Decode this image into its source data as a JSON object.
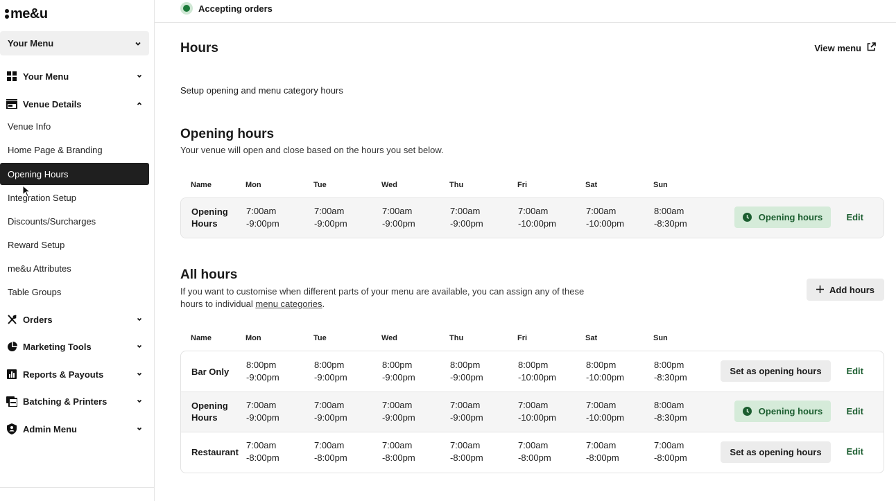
{
  "brand": {
    "logo_text": "me&u"
  },
  "sidebar": {
    "menu_select": "Your Menu",
    "groups": {
      "your_menu": "Your Menu",
      "venue_details": "Venue Details",
      "orders": "Orders",
      "marketing_tools": "Marketing Tools",
      "reports_payouts": "Reports & Payouts",
      "batching_printers": "Batching & Printers",
      "admin_menu": "Admin Menu"
    },
    "venue_items": [
      "Venue Info",
      "Home Page & Branding",
      "Opening Hours",
      "Integration Setup",
      "Discounts/Surcharges",
      "Reward Setup",
      "me&u Attributes",
      "Table Groups"
    ],
    "active_item": "Opening Hours"
  },
  "topbar": {
    "status": "Accepting orders",
    "status_color": "#1c7a3a"
  },
  "page": {
    "title": "Hours",
    "view_menu": "View menu",
    "subtitle": "Setup opening and menu category hours"
  },
  "opening_hours": {
    "title": "Opening hours",
    "description": "Your venue will open and close based on the hours you set below."
  },
  "all_hours": {
    "title": "All hours",
    "description_before": "If you want to customise when different parts of your menu are available, you can assign any of these hours to individual ",
    "description_link": "menu categories",
    "description_after": ".",
    "add_button": "Add hours"
  },
  "columns": [
    "Name",
    "Mon",
    "Tue",
    "Wed",
    "Thu",
    "Fri",
    "Sat",
    "Sun"
  ],
  "labels": {
    "opening_badge": "Opening hours",
    "set_as_opening": "Set as opening hours",
    "edit": "Edit"
  },
  "opening_rows": [
    {
      "name": [
        "Opening",
        "Hours"
      ],
      "times": [
        [
          "7:00am",
          "-9:00pm"
        ],
        [
          "7:00am",
          "-9:00pm"
        ],
        [
          "7:00am",
          "-9:00pm"
        ],
        [
          "7:00am",
          "-9:00pm"
        ],
        [
          "7:00am",
          "-10:00pm"
        ],
        [
          "7:00am",
          "-10:00pm"
        ],
        [
          "8:00am",
          "-8:30pm"
        ]
      ],
      "is_opening": true
    }
  ],
  "all_rows": [
    {
      "name": [
        "Bar Only"
      ],
      "times": [
        [
          "8:00pm",
          "-9:00pm"
        ],
        [
          "8:00pm",
          "-9:00pm"
        ],
        [
          "8:00pm",
          "-9:00pm"
        ],
        [
          "8:00pm",
          "-9:00pm"
        ],
        [
          "8:00pm",
          "-10:00pm"
        ],
        [
          "8:00pm",
          "-10:00pm"
        ],
        [
          "8:00pm",
          "-8:30pm"
        ]
      ],
      "is_opening": false
    },
    {
      "name": [
        "Opening",
        "Hours"
      ],
      "times": [
        [
          "7:00am",
          "-9:00pm"
        ],
        [
          "7:00am",
          "-9:00pm"
        ],
        [
          "7:00am",
          "-9:00pm"
        ],
        [
          "7:00am",
          "-9:00pm"
        ],
        [
          "7:00am",
          "-10:00pm"
        ],
        [
          "7:00am",
          "-10:00pm"
        ],
        [
          "8:00am",
          "-8:30pm"
        ]
      ],
      "is_opening": true
    },
    {
      "name": [
        "Restaurant"
      ],
      "times": [
        [
          "7:00am",
          "-8:00pm"
        ],
        [
          "7:00am",
          "-8:00pm"
        ],
        [
          "7:00am",
          "-8:00pm"
        ],
        [
          "7:00am",
          "-8:00pm"
        ],
        [
          "7:00am",
          "-8:00pm"
        ],
        [
          "7:00am",
          "-8:00pm"
        ],
        [
          "7:00am",
          "-8:00pm"
        ]
      ],
      "is_opening": false
    }
  ]
}
